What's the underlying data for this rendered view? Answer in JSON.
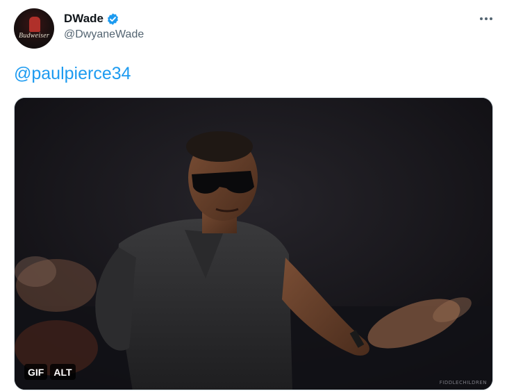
{
  "tweet": {
    "author": {
      "display_name": "DWade",
      "handle": "@DwyaneWade",
      "verified": true,
      "avatar_text": "Budweiser",
      "avatar_icon": "avatar"
    },
    "more_icon": "more-horizontal-icon",
    "text": {
      "mention": "@paulpierce34"
    },
    "media": {
      "type": "gif",
      "gif_badge": "GIF",
      "alt_badge": "ALT",
      "watermark": "FIDDLECHILDREN"
    }
  },
  "colors": {
    "link": "#1d9bf0",
    "verified": "#1d9bf0",
    "name": "#0f1419",
    "secondary": "#536471",
    "border": "#cfd9de"
  }
}
